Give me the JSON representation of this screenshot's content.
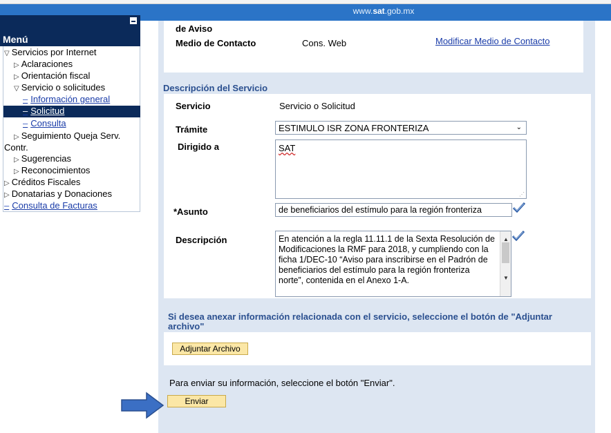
{
  "header": {
    "site_prefix": "www.",
    "site_bold": "sat",
    "site_suffix": ".gob.mx"
  },
  "menu": {
    "title": "Menú",
    "items": [
      {
        "label": "Servicios por Internet",
        "twisty": "▽"
      },
      {
        "label": "Aclaraciones",
        "twisty": "▷"
      },
      {
        "label": "Orientación fiscal",
        "twisty": "▷"
      },
      {
        "label": "Servicio o solicitudes",
        "twisty": "▽"
      },
      {
        "label": "Información general"
      },
      {
        "label": "Solicitud"
      },
      {
        "label": "Consulta"
      },
      {
        "label": "Seguimiento Queja Serv.",
        "twisty": "▷"
      },
      {
        "label": "Contr."
      },
      {
        "label": "Sugerencias",
        "twisty": "▷"
      },
      {
        "label": "Reconocimientos",
        "twisty": "▷"
      },
      {
        "label": "Créditos Fiscales",
        "twisty": "▷"
      },
      {
        "label": "Donatarias y Donaciones",
        "twisty": "▷"
      },
      {
        "label": "Consulta de Facturas"
      }
    ],
    "dash": "–"
  },
  "contact": {
    "cut_label": "de Aviso",
    "medio_label": "Medio de Contacto",
    "medio_value": "Cons. Web",
    "modify_link": "Modificar Medio de Contacto"
  },
  "service": {
    "section_title": "Descripción del Servicio",
    "servicio_label": "Servicio",
    "servicio_value": "Servicio o Solicitud",
    "tramite_label": "Trámite",
    "tramite_value": "ESTIMULO ISR ZONA FRONTERIZA",
    "dirigido_label": "Dirigido a",
    "dirigido_value": "SAT",
    "asunto_label": "*Asunto",
    "asunto_value": "de beneficiarios del estímulo para la región fronteriza",
    "descripcion_label": "Descripción",
    "descripcion_value": "En atención a la regla 11.11.1 de la Sexta Resolución de Modificaciones la RMF para 2018, y cumpliendo con la ficha 1/DEC-10 “Aviso para inscribirse en el Padrón de beneficiarios del estímulo para la región fronteriza norte”, contenida en el Anexo 1-A."
  },
  "attach": {
    "title": "Si desea anexar información relacionada con el servicio, seleccione el botón de \"Adjuntar archivo\"",
    "button": "Adjuntar Archivo"
  },
  "send": {
    "instruction": "Para enviar su información, seleccione el botón \"Enviar\".",
    "button": "Enviar"
  },
  "colors": {
    "banner": "#2b74c7",
    "menu_dark": "#0b2a5a",
    "panel": "#dde6f2",
    "button": "#fbe7a6",
    "arrow": "#3b6fc4"
  }
}
